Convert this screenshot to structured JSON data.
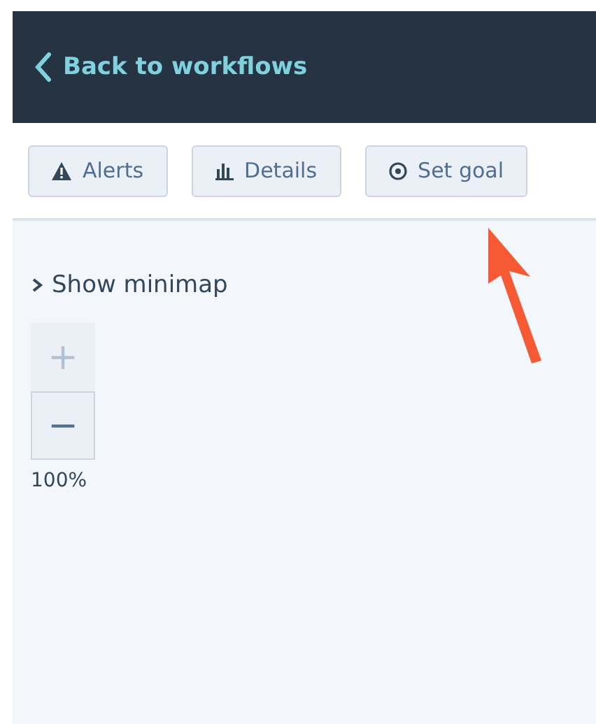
{
  "header": {
    "back_link": "Back to workflows"
  },
  "toolbar": {
    "buttons": [
      {
        "kind": "alert",
        "label": "Alerts"
      },
      {
        "kind": "chart",
        "label": "Details"
      },
      {
        "kind": "target",
        "label": "Set goal"
      }
    ]
  },
  "canvas": {
    "minimap_toggle": {
      "label": "Show minimap",
      "expanded": false
    },
    "zoom_controls": [
      {
        "symbol": "+",
        "disabled": true
      },
      {
        "symbol": "−",
        "disabled": false
      }
    ],
    "zoom_level": "100%"
  },
  "annotation": {
    "kind": "arrow",
    "color": "#f55a35"
  }
}
